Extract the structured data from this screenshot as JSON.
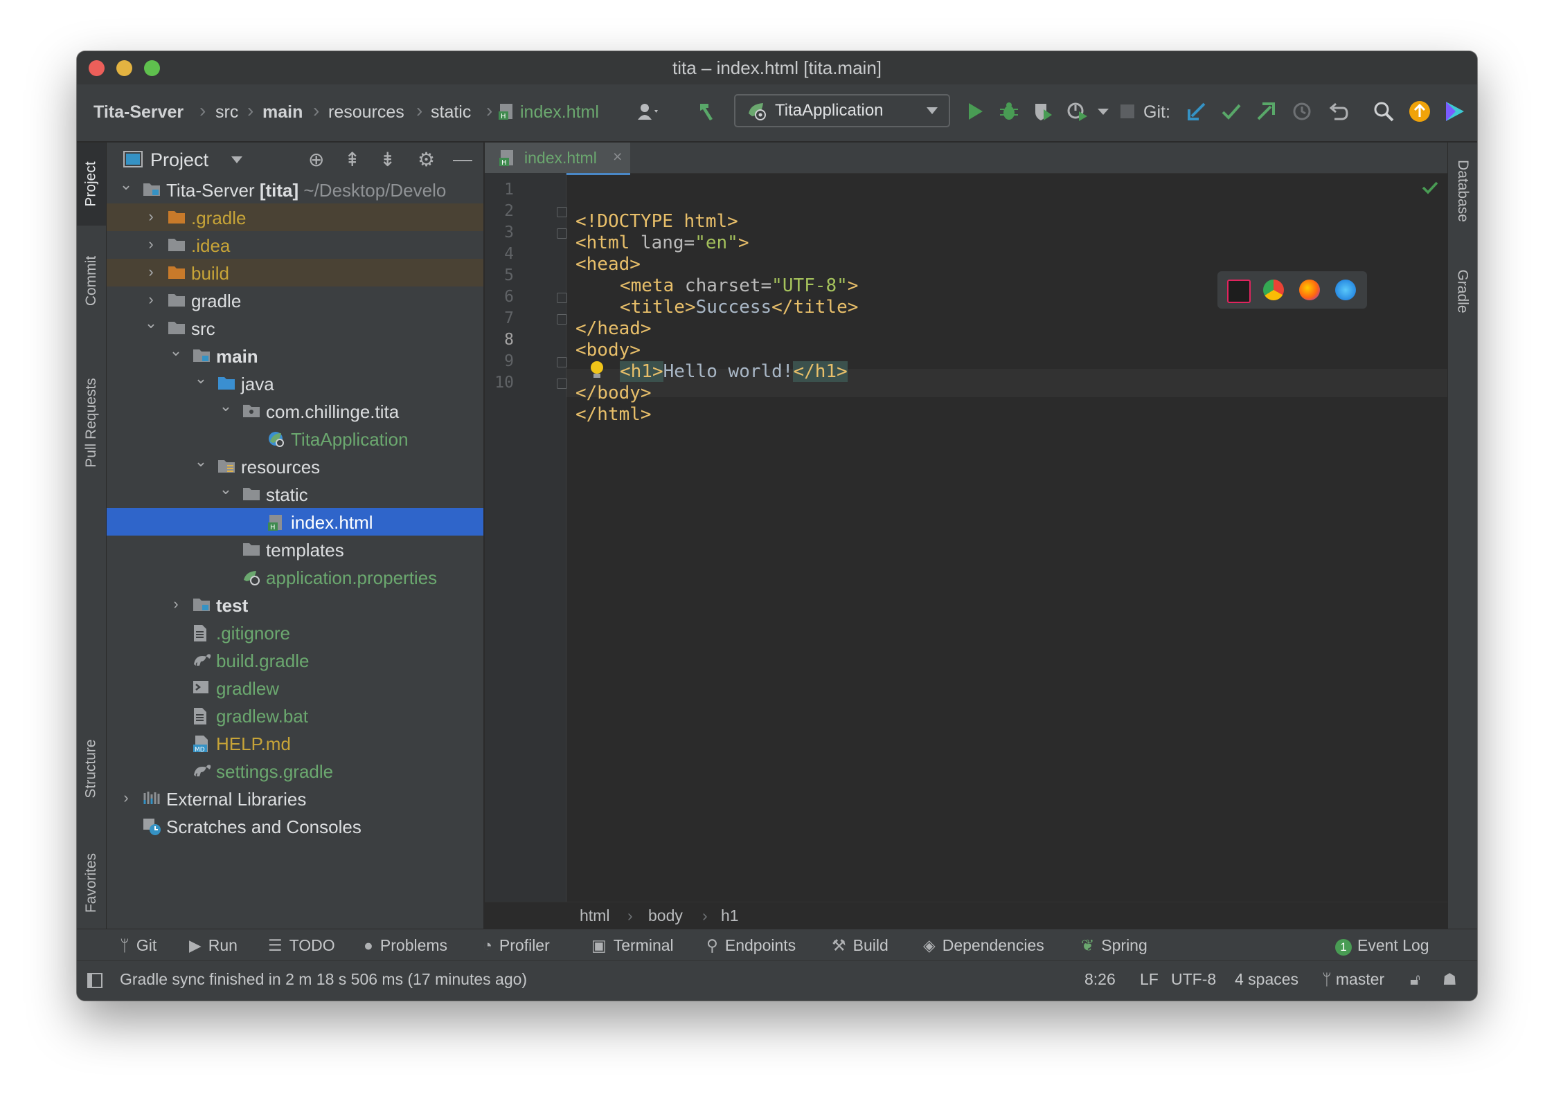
{
  "window": {
    "title": "tita – index.html [tita.main]"
  },
  "navbar": {
    "breadcrumbs": [
      "Tita-Server",
      "src",
      "main",
      "resources",
      "static",
      "index.html"
    ],
    "run_config": "TitaApplication",
    "git_label": "Git:"
  },
  "left_tabs": [
    "Project",
    "Commit",
    "Pull Requests",
    "Structure",
    "Favorites"
  ],
  "right_tabs": [
    "Database",
    "Gradle"
  ],
  "project_panel": {
    "title": "Project",
    "tree": [
      {
        "label": "Tita-Server",
        "suffix": "[tita]",
        "path": "~/Desktop/Develo",
        "color": "#dcdee0"
      },
      {
        "label": ".gradle",
        "color": "#c7a438"
      },
      {
        "label": ".idea",
        "color": "#c7a438"
      },
      {
        "label": "build",
        "color": "#c7a438"
      },
      {
        "label": "gradle",
        "color": "#dcdee0"
      },
      {
        "label": "src",
        "color": "#dcdee0"
      },
      {
        "label": "main",
        "color": "#dcdee0"
      },
      {
        "label": "java",
        "color": "#dcdee0"
      },
      {
        "label": "com.chillinge.tita",
        "color": "#dcdee0"
      },
      {
        "label": "TitaApplication",
        "color": "#6ba86f"
      },
      {
        "label": "resources",
        "color": "#dcdee0"
      },
      {
        "label": "static",
        "color": "#dcdee0"
      },
      {
        "label": "index.html",
        "color": "#ffffff"
      },
      {
        "label": "templates",
        "color": "#dcdee0"
      },
      {
        "label": "application.properties",
        "color": "#6ba86f"
      },
      {
        "label": "test",
        "color": "#dcdee0"
      },
      {
        "label": ".gitignore",
        "color": "#6ba86f"
      },
      {
        "label": "build.gradle",
        "color": "#6ba86f"
      },
      {
        "label": "gradlew",
        "color": "#6ba86f"
      },
      {
        "label": "gradlew.bat",
        "color": "#6ba86f"
      },
      {
        "label": "HELP.md",
        "color": "#c7a438"
      },
      {
        "label": "settings.gradle",
        "color": "#6ba86f"
      },
      {
        "label": "External Libraries",
        "color": "#dcdee0"
      },
      {
        "label": "Scratches and Consoles",
        "color": "#dcdee0"
      }
    ]
  },
  "editor": {
    "tab_label": "index.html",
    "line_numbers": [
      "1",
      "2",
      "3",
      "4",
      "5",
      "6",
      "7",
      "8",
      "9",
      "10"
    ],
    "code": {
      "l1": "<!DOCTYPE html>",
      "l2_tag": "<html",
      "l2_attr": " lang=",
      "l2_str": "\"en\"",
      "l2_end": ">",
      "l3": "<head>",
      "l4_tag": "<meta",
      "l4_attr": " charset=",
      "l4_str": "\"UTF-8\"",
      "l4_end": ">",
      "l5_open": "<title>",
      "l5_text": "Success",
      "l5_close": "</title>",
      "l6": "</head>",
      "l7": "<body>",
      "l8_open": "<h1>",
      "l8_text": "Hello world!",
      "l8_close": "</h1>",
      "l9": "</body>",
      "l10": "</html>"
    },
    "breadcrumbs": [
      "html",
      "body",
      "h1"
    ]
  },
  "bottom_tools": [
    "Git",
    "Run",
    "TODO",
    "Problems",
    "Profiler",
    "Terminal",
    "Endpoints",
    "Build",
    "Dependencies",
    "Spring"
  ],
  "event_log": {
    "label": "Event Log",
    "count": "1"
  },
  "status": {
    "message": "Gradle sync finished in 2 m 18 s 506 ms (17 minutes ago)",
    "position": "8:26",
    "line_ending": "LF",
    "encoding": "UTF-8",
    "indent": "4 spaces",
    "branch": "master"
  }
}
